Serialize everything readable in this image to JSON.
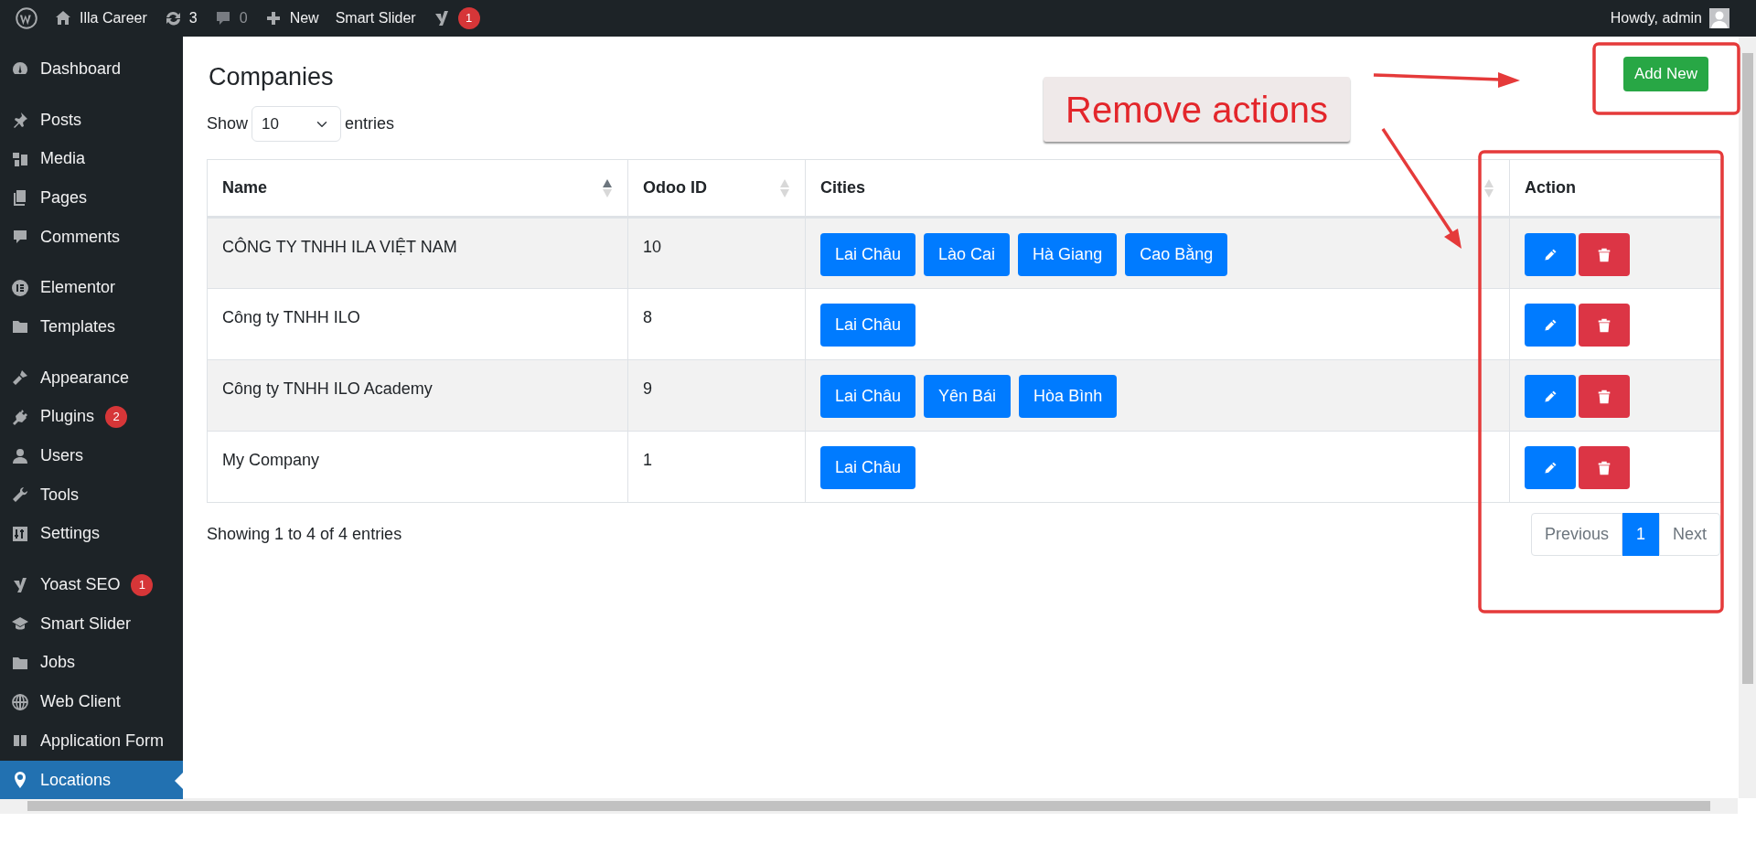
{
  "admin_bar": {
    "items": [
      {
        "label": "Illa Career",
        "muted": false
      },
      {
        "label": "3",
        "muted": false
      },
      {
        "label": "0",
        "muted": true
      },
      {
        "label": "New",
        "muted": false
      },
      {
        "label": "Smart Slider",
        "muted": false
      },
      {
        "badge": "1",
        "muted": false
      }
    ],
    "greeting": "Howdy, admin"
  },
  "sidebar": {
    "groups": [
      {
        "items": [
          {
            "label": "Dashboard",
            "selected": false
          }
        ]
      },
      {
        "items": [
          {
            "label": "Posts",
            "selected": false
          },
          {
            "label": "Media",
            "selected": false
          },
          {
            "label": "Pages",
            "selected": false
          },
          {
            "label": "Comments",
            "selected": false
          }
        ]
      },
      {
        "items": [
          {
            "label": "Elementor",
            "selected": false
          },
          {
            "label": "Templates",
            "selected": false
          }
        ]
      },
      {
        "items": [
          {
            "label": "Appearance",
            "selected": false
          },
          {
            "label": "Plugins",
            "badge": "2",
            "selected": false
          },
          {
            "label": "Users",
            "selected": false
          },
          {
            "label": "Tools",
            "selected": false
          },
          {
            "label": "Settings",
            "selected": false
          }
        ]
      },
      {
        "items": [
          {
            "label": "Yoast SEO",
            "badge": "1",
            "selected": false
          },
          {
            "label": "Smart Slider",
            "selected": false
          },
          {
            "label": "Jobs",
            "selected": false
          },
          {
            "label": "Web Client",
            "selected": false
          },
          {
            "label": "Application Form",
            "selected": false
          },
          {
            "label": "Locations",
            "selected": true
          }
        ]
      }
    ]
  },
  "page": {
    "title": "Companies",
    "add_button": "Add New",
    "length": {
      "before": "Show",
      "value": "10",
      "after": "entries"
    },
    "table": {
      "columns": [
        {
          "label": "Name",
          "sorted": true
        },
        {
          "label": "Odoo ID",
          "sorted": false
        },
        {
          "label": "Cities",
          "sorted": false
        },
        {
          "label": "Action"
        }
      ],
      "rows": [
        {
          "name": "CÔNG TY TNHH ILA VIỆT NAM",
          "odoo_id": "10",
          "cities": [
            "Lai Châu",
            "Lào Cai",
            "Hà Giang",
            "Cao Bằng"
          ]
        },
        {
          "name": "Công ty TNHH ILO",
          "odoo_id": "8",
          "cities": [
            "Lai Châu"
          ]
        },
        {
          "name": "Công ty TNHH ILO Academy",
          "odoo_id": "9",
          "cities": [
            "Lai Châu",
            "Yên Bái",
            "Hòa Bình"
          ]
        },
        {
          "name": "My Company",
          "odoo_id": "1",
          "cities": [
            "Lai Châu"
          ]
        }
      ]
    },
    "info": "Showing 1 to 4 of 4 entries",
    "pagination": [
      {
        "label": "Previous",
        "selected": false,
        "disabled": true
      },
      {
        "label": "1",
        "selected": true,
        "disabled": false
      },
      {
        "label": "Next",
        "selected": false,
        "disabled": true
      }
    ]
  },
  "annotation": {
    "callout": "Remove actions"
  }
}
